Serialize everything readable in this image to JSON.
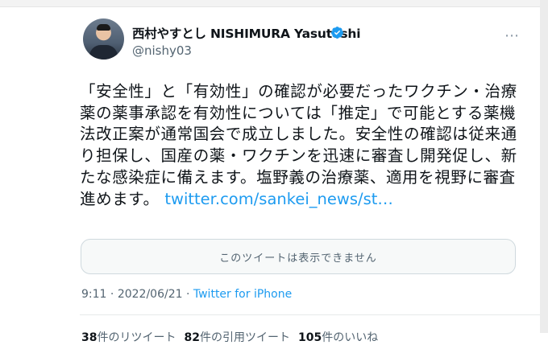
{
  "profile": {
    "display_name": "西村やすとし NISHIMURA Yasutoshi",
    "handle": "@nishy03"
  },
  "tweet": {
    "text": "「安全性」と「有効性」の確認が必要だったワクチン・治療薬の薬事承認を有効性については「推定」で可能とする薬機法改正案が通常国会で成立しました。安全性の確認は従来通り担保し、国産の薬・ワクチンを迅速に審査し開発促し、新たな感染症に備えます。塩野義の治療薬、適用を視野に審査進めます。 ",
    "link": "twitter.com/sankei_news/st…",
    "unavailable_notice": "このツイートは表示できません",
    "time": "9:11",
    "separator": " · ",
    "date": "2022/06/21",
    "source": "Twitter for iPhone"
  },
  "stats": {
    "retweets_count": "38",
    "retweets_label": "件のリツイート",
    "quotes_count": "82",
    "quotes_label": "件の引用ツイート",
    "likes_count": "105",
    "likes_label": "件のいいね"
  },
  "colors": {
    "accent": "#1d9bf0",
    "text": "#0f1419",
    "secondary": "#536471"
  },
  "icons": {
    "verified": "verified-badge-icon",
    "more": "more-options-icon"
  }
}
